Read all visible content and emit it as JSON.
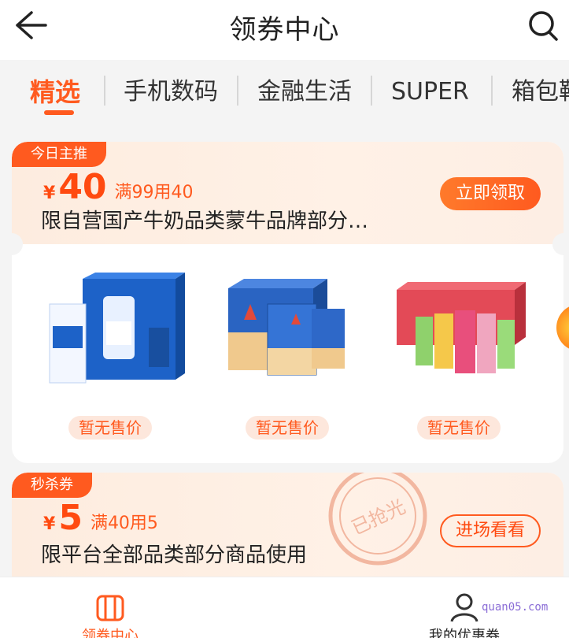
{
  "header": {
    "title": "领券中心"
  },
  "tabs": [
    {
      "label": "精选",
      "active": true
    },
    {
      "label": "手机数码"
    },
    {
      "label": "金融生活"
    },
    {
      "label": "SUPER"
    },
    {
      "label": "箱包鞋"
    }
  ],
  "coupons": [
    {
      "badge": "今日主推",
      "currency": "¥",
      "amount": "40",
      "condition": "满99用40",
      "description": "限自营国产牛奶品类蒙牛品牌部分…",
      "button": "立即领取",
      "products": [
        {
          "image_icon": "milk-gift-box-image",
          "price_label": "暂无售价"
        },
        {
          "image_icon": "pure-milk-box-image",
          "price_label": "暂无售价"
        },
        {
          "image_icon": "juice-gift-box-image",
          "price_label": "暂无售价"
        }
      ]
    },
    {
      "badge": "秒杀券",
      "currency": "¥",
      "amount": "5",
      "condition": "满40用5",
      "description": "限平台全部品类部分商品使用",
      "button": "进场看看",
      "stamp_text": "已抢光"
    }
  ],
  "bottom_nav": [
    {
      "label": "领券中心",
      "icon": "coupon-center-icon",
      "active": true
    },
    {
      "label": "我的优惠券",
      "icon": "user-coupon-icon"
    }
  ],
  "watermark": "quan05.com",
  "colors": {
    "accent": "#ff5a1f",
    "badge": "#ff5a1f",
    "price_tag_bg": "#fde7dc"
  }
}
